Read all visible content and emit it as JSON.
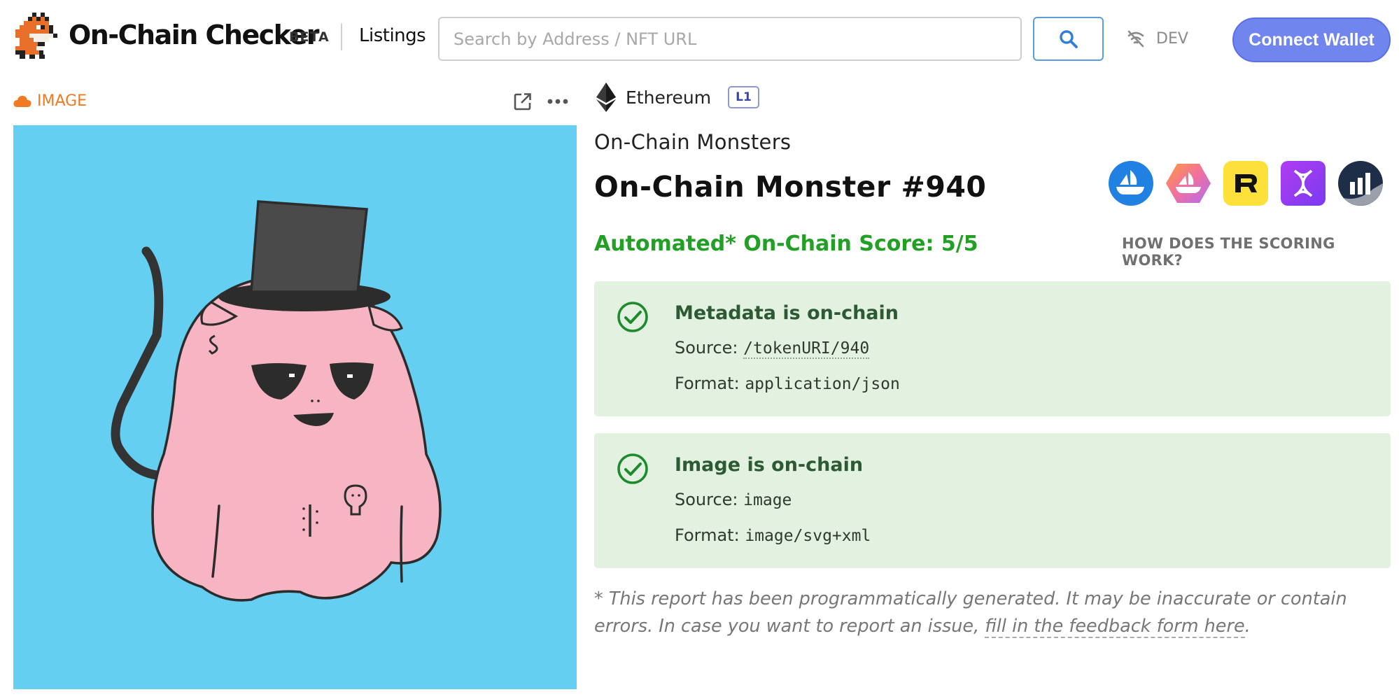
{
  "header": {
    "brand": "On-Chain Checker",
    "beta": "BETA",
    "listings_label": "Listings",
    "search_placeholder": "Search by Address / NFT URL",
    "dev_label": "DEV",
    "connect_label": "Connect Wallet"
  },
  "left_panel": {
    "media_label": "IMAGE",
    "background_color": "#64cff1"
  },
  "token": {
    "chain": "Ethereum",
    "chain_badge": "L1",
    "collection": "On-Chain Monsters",
    "title": "On-Chain Monster #940",
    "marketplaces": [
      {
        "name": "opensea-icon",
        "color": "#2081e2"
      },
      {
        "name": "looksrare-hex-icon",
        "color": "#f06fa0"
      },
      {
        "name": "rarible-icon",
        "color": "#fde13a"
      },
      {
        "name": "dna-marketplace-icon",
        "color": "#9b3df0"
      },
      {
        "name": "nft-stats-icon",
        "color": "#1e2e48"
      }
    ]
  },
  "score": {
    "text": "Automated* On-Chain Score: 5/5",
    "how_link": "HOW DOES THE SCORING WORK?",
    "accent": "#22a025"
  },
  "checks": [
    {
      "title": "Metadata is on-chain",
      "source_label": "Source:",
      "source_value": "/tokenURI/940",
      "format_label": "Format:",
      "format_value": "application/json"
    },
    {
      "title": "Image is on-chain",
      "source_label": "Source:",
      "source_value": "image",
      "format_label": "Format:",
      "format_value": "image/svg+xml"
    }
  ],
  "disclaimer": {
    "text": "* This report has been programmatically generated. It may be inaccurate or contain errors. In case you want to report an issue, ",
    "link_text": "fill in the feedback form here",
    "end": "."
  }
}
